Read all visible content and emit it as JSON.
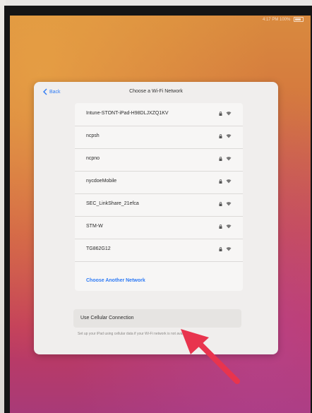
{
  "status_bar": {
    "text": "4:17 PM 100%"
  },
  "sheet": {
    "back_label": "Back",
    "title": "Choose a Wi-Fi Network"
  },
  "networks": [
    {
      "name": "Intune-STONT-iPad-H98DLJXZQ1KV"
    },
    {
      "name": "ncpsh"
    },
    {
      "name": "ncpno"
    },
    {
      "name": "nycdoeMobile"
    },
    {
      "name": "SEC_LinkShare_21efca"
    },
    {
      "name": "STM-W"
    },
    {
      "name": "TG862G12"
    }
  ],
  "choose_another_label": "Choose Another Network",
  "cellular": {
    "label": "Use Cellular Connection",
    "footer": "Set up your iPad using cellular data if your Wi-Fi network is not available."
  },
  "colors": {
    "accent": "#2f7bf5",
    "arrow": "#e8344e"
  }
}
